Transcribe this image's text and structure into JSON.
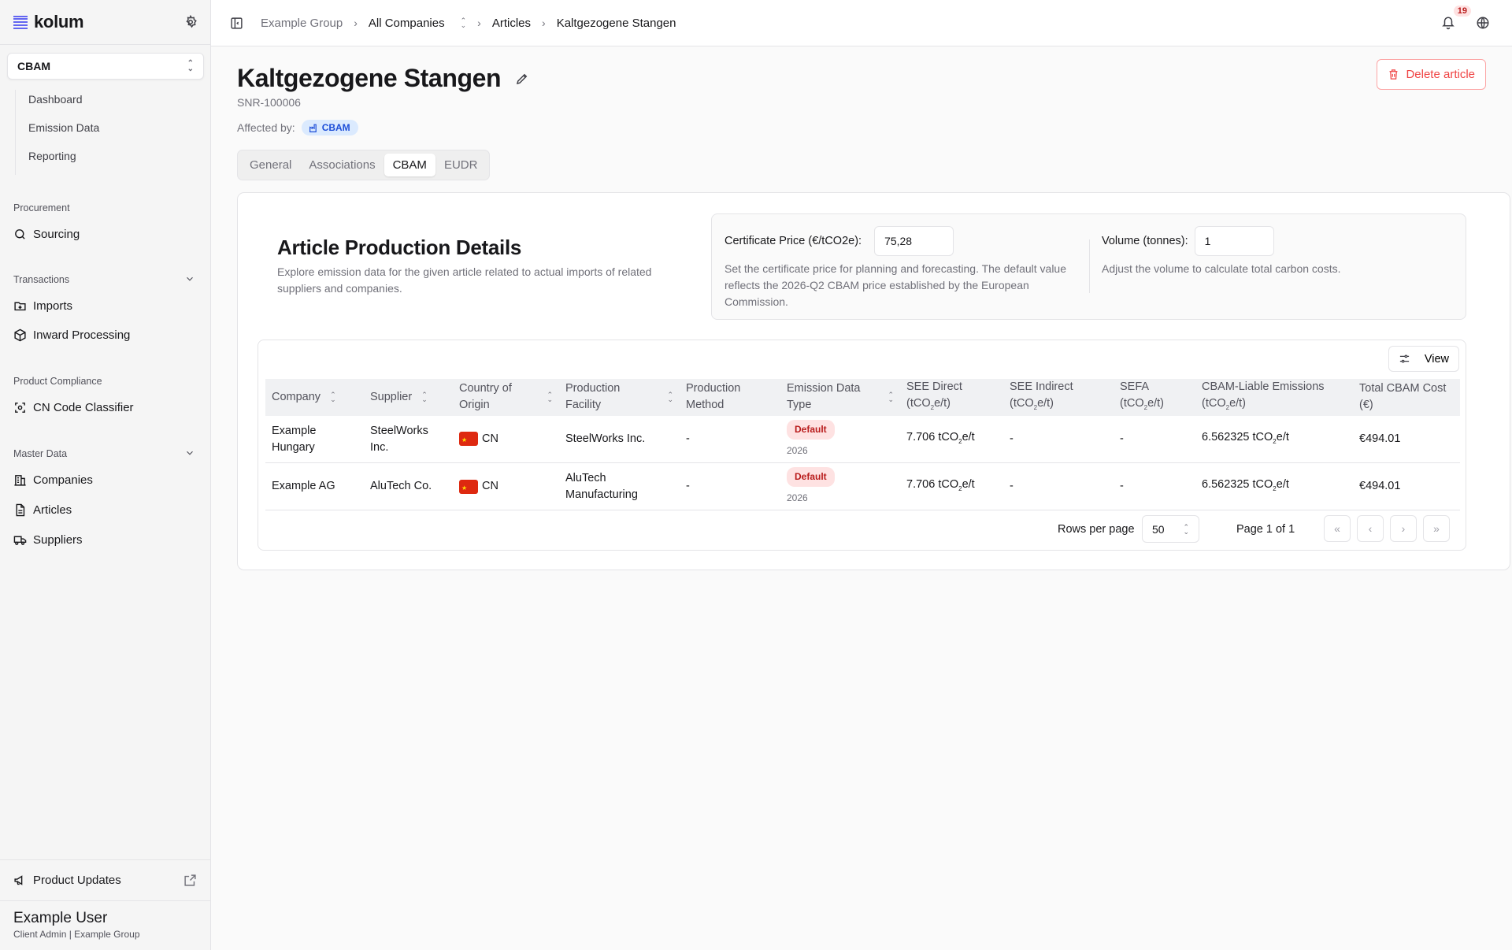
{
  "sidebar": {
    "logo": "kolum",
    "module": "CBAM",
    "subnav": [
      "Dashboard",
      "Emission Data",
      "Reporting"
    ],
    "sections": {
      "procurement": "Procurement",
      "transactions": "Transactions",
      "product_compliance": "Product Compliance",
      "master_data": "Master Data"
    },
    "items": {
      "sourcing": "Sourcing",
      "imports": "Imports",
      "inward_processing": "Inward Processing",
      "cn_code_classifier": "CN Code Classifier",
      "companies": "Companies",
      "articles": "Articles",
      "suppliers": "Suppliers"
    },
    "product_updates": "Product Updates",
    "user": {
      "name": "Example User",
      "role": "Client Admin | Example Group"
    }
  },
  "topbar": {
    "breadcrumb": [
      "Example Group",
      "All Companies",
      "Articles",
      "Kaltgezogene Stangen"
    ],
    "notifications": "19"
  },
  "article": {
    "title": "Kaltgezogene Stangen",
    "sku": "SNR-100006",
    "affected_label": "Affected by:",
    "affected_badge": "CBAM",
    "delete_label": "Delete article",
    "tabs": [
      "General",
      "Associations",
      "CBAM",
      "EUDR"
    ],
    "active_tab": "CBAM"
  },
  "details": {
    "title": "Article Production Details",
    "subtitle": "Explore emission data for the given article related to actual imports of related suppliers and companies.",
    "certificate_label": "Certificate Price (€/tCO2e):",
    "certificate_value": "75,28",
    "certificate_help": "Set the certificate price for planning and forecasting. The default value reflects the 2026-Q2 CBAM price established by the European Commission.",
    "volume_label": "Volume (tonnes):",
    "volume_value": "1",
    "volume_help": "Adjust the volume to calculate total carbon costs."
  },
  "table": {
    "view_label": "View",
    "columns": {
      "company": "Company",
      "supplier": "Supplier",
      "origin": "Country of Origin",
      "facility": "Production Facility",
      "method": "Production Method",
      "emission_type": "Emission Data Type",
      "see_direct": "SEE Direct",
      "see_indirect": "SEE Indirect",
      "sefa": "SEFA",
      "cbam_liable": "CBAM-Liable Emissions",
      "total_cost": "Total CBAM Cost",
      "total_cost_unit": "(€)"
    },
    "rows": [
      {
        "company": "Example Hungary",
        "supplier": "SteelWorks Inc.",
        "country": "CN",
        "facility": "SteelWorks Inc.",
        "method": "-",
        "type_badge": "Default",
        "type_year": "2026",
        "see_direct": "7.706",
        "see_indirect": "-",
        "sefa": "-",
        "cbam_liable": "6.562325",
        "total_cost": "€494.01"
      },
      {
        "company": "Example AG",
        "supplier": "AluTech Co.",
        "country": "CN",
        "facility": "AluTech Manufacturing",
        "method": "-",
        "type_badge": "Default",
        "type_year": "2026",
        "see_direct": "7.706",
        "see_indirect": "-",
        "sefa": "-",
        "cbam_liable": "6.562325",
        "total_cost": "€494.01"
      }
    ],
    "rows_per_page_label": "Rows per page",
    "rows_per_page": "50",
    "page_info": "Page 1 of 1"
  }
}
